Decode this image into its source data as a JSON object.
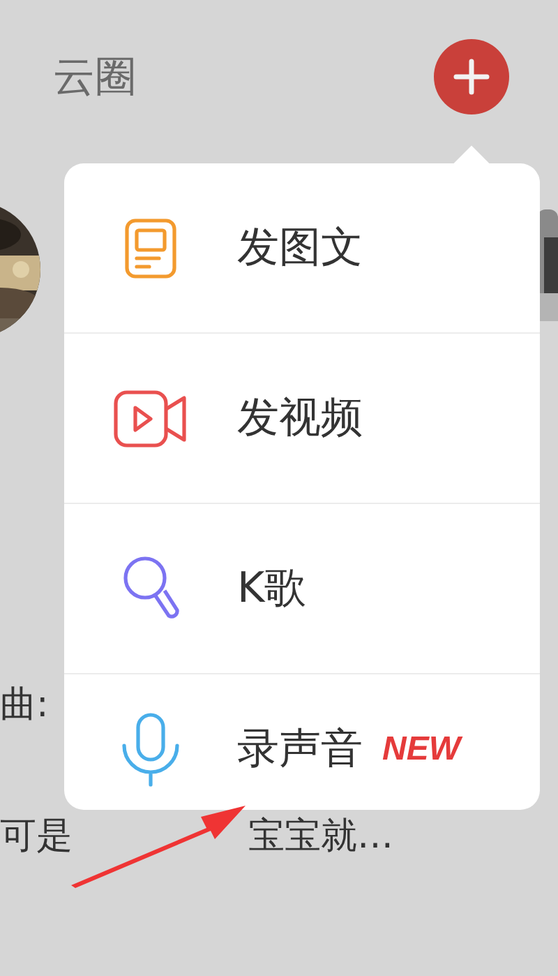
{
  "header": {
    "title": "云圈"
  },
  "feed": {
    "caption_1": "曲:",
    "caption_2_start": "可是",
    "caption_2_end": "宝宝就…"
  },
  "menu": {
    "items": [
      {
        "kind": "post",
        "label": "发图文"
      },
      {
        "kind": "video",
        "label": "发视频"
      },
      {
        "kind": "karaoke",
        "label": "K歌"
      },
      {
        "kind": "voice",
        "label": "录声音",
        "badge": "NEW"
      }
    ]
  }
}
